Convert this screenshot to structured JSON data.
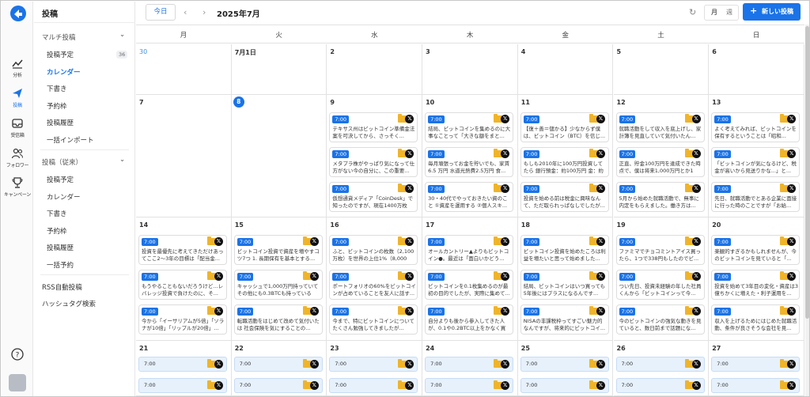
{
  "app": {
    "brand_color": "#1a73e8"
  },
  "rail": [
    {
      "label": "分析",
      "icon": "chart-icon"
    },
    {
      "label": "投稿",
      "icon": "send-icon",
      "active": true
    },
    {
      "label": "受信箱",
      "icon": "inbox-icon"
    },
    {
      "label": "フォロワー",
      "icon": "users-icon"
    },
    {
      "label": "キャンペーン",
      "icon": "trophy-icon"
    }
  ],
  "side": {
    "title": "投稿",
    "group1": {
      "label": "マルチ投稿",
      "items": [
        {
          "label": "投稿予定",
          "badge": "36"
        },
        {
          "label": "カレンダー",
          "active": true
        },
        {
          "label": "下書き"
        },
        {
          "label": "予約枠"
        },
        {
          "label": "投稿履歴"
        },
        {
          "label": "一括インポート"
        }
      ]
    },
    "group2": {
      "label": "投稿（従来）",
      "items": [
        {
          "label": "投稿予定"
        },
        {
          "label": "カレンダー"
        },
        {
          "label": "下書き"
        },
        {
          "label": "予約枠"
        },
        {
          "label": "投稿履歴"
        },
        {
          "label": "一括予約"
        }
      ]
    },
    "extra": [
      {
        "label": "RSS自動投稿"
      },
      {
        "label": "ハッシュタグ検索"
      }
    ]
  },
  "toolbar": {
    "today": "今日",
    "prev": "‹",
    "next": "›",
    "month": "2025年7月",
    "view_month": "月",
    "view_week": "週",
    "new_post": "新しい投稿",
    "new_post_plus": "+"
  },
  "calendar": {
    "weekdays": [
      "月",
      "火",
      "水",
      "木",
      "金",
      "土",
      "日"
    ],
    "weeks": [
      {
        "days": [
          {
            "num": "30",
            "muted": true,
            "posts": []
          },
          {
            "num": "7月1日",
            "posts": []
          },
          {
            "num": "2",
            "posts": []
          },
          {
            "num": "3",
            "posts": []
          },
          {
            "num": "4",
            "posts": []
          },
          {
            "num": "5",
            "posts": []
          },
          {
            "num": "6",
            "posts": []
          }
        ]
      },
      {
        "days": [
          {
            "num": "7",
            "posts": []
          },
          {
            "num": "8",
            "today": true,
            "posts": []
          },
          {
            "num": "9",
            "posts": [
              {
                "time": "7:00",
                "text": "テキサス州はビットコイン準備金法案を可決してから、さっそく..."
              },
              {
                "time": "7:00",
                "text": "メタプラ株がやっぱり気になって仕方がない今の自分に、この重要..."
              },
              {
                "time": "7:00",
                "text": "仮想通貨メディア「CoinDesk」で知ったのですが、現在1400万枚も..."
              }
            ]
          },
          {
            "num": "10",
            "posts": [
              {
                "time": "7:00",
                "text": "結局、ビットコインを集めるのに大事なことって「大きな額をまと..."
              },
              {
                "time": "7:00",
                "text": "毎月頑張ってお金を貯いでも、家賃6.5 万円 水道光熱費2.5万円 食..."
              },
              {
                "time": "7:00",
                "text": "30・40代でやっておきたい資のこと ①資産を運用する ②個人スキ..."
              }
            ]
          },
          {
            "num": "11",
            "posts": [
              {
                "time": "7:00",
                "text": "【復＋善＝儲かる】少なからず僕は、ビットコイン（BTC）を信じ..."
              },
              {
                "time": "7:00",
                "text": "もしも2010年に100万円投資してたら 銀行預金：約100万円 金：約3..."
              },
              {
                "time": "7:00",
                "text": "投資を始める前は税金に興味なんて、ただ取られっぱなしでしたが..."
              }
            ]
          },
          {
            "num": "12",
            "posts": [
              {
                "time": "7:00",
                "text": "就職活動をして収入を底上げし、家計簿を見直していて気付いたん..."
              },
              {
                "time": "7:00",
                "text": "正直、貯金100万円を達成できた時点で、僕は将来1,000万円とか1億..."
              },
              {
                "time": "7:00",
                "text": "5月から始めた就職活動で、無事に内定をもらえました。働き方は..."
              }
            ]
          },
          {
            "num": "13",
            "posts": [
              {
                "time": "7:00",
                "text": "よく考えてみれば、ビットコインを保有するということは「昭和..."
              },
              {
                "time": "7:00",
                "text": "「ビットコインが気になるけど、税金が高いから見送りかな...」と..."
              },
              {
                "time": "7:00",
                "text": "先日、就職活動でとある企業に面接に行った時のことですが「お給..."
              }
            ]
          }
        ]
      },
      {
        "days": [
          {
            "num": "14",
            "posts": [
              {
                "time": "7:00",
                "text": "投資を最優先に考えてきただけあってここ2〜3年の目標は「配当金..."
              },
              {
                "time": "7:00",
                "text": "もうやることもないだろうけど...レバレッジ投資で負けたのに、そ..."
              },
              {
                "time": "7:00",
                "text": "今から「イーサリアムが5倍」「ソラナが10倍」「リップルが20倍」..."
              }
            ]
          },
          {
            "num": "15",
            "posts": [
              {
                "time": "7:00",
                "text": "ビットコイン投資で資産を増やすコツ7つ 1. 長期保有を基本とする..."
              },
              {
                "time": "7:00",
                "text": "キャッシュで1,000万円持っていてその他にも0.3BTCも持っているか..."
              },
              {
                "time": "7:00",
                "text": "転職活動をはじめて改めて気付いたは 社会保険を気にすることの..."
              }
            ]
          },
          {
            "num": "16",
            "posts": [
              {
                "time": "7:00",
                "text": "ふと、ビットコインの枚数（2,100万枚）を世界の上位1%（8,000万..."
              },
              {
                "time": "7:00",
                "text": "ポートフォリオの60%をビットコインが占めていることを友人に話す..."
              },
              {
                "time": "7:00",
                "text": "今まで、特にビットコインについてたくさん勉強してきましたが..."
              }
            ]
          },
          {
            "num": "17",
            "posts": [
              {
                "time": "7:00",
                "text": "オールカントリー▲よりもビットコイン●。最近は「面白いかどう..."
              },
              {
                "time": "7:00",
                "text": "ビットコインを0.1枚集めるのが最初の目的でしたが、実際に集めて..."
              },
              {
                "time": "7:00",
                "text": "自分よりも後から参入してきた人が、0.1や0.2BTC以上をかなく買い..."
              }
            ]
          },
          {
            "num": "18",
            "posts": [
              {
                "time": "7:00",
                "text": "ビットコイン投資を始めたころは利益を増たいと思って始めました..."
              },
              {
                "time": "7:00",
                "text": "結局、ビットコインはいつ買っても5年後にはプラスになるんです..."
              },
              {
                "time": "7:00",
                "text": "NISAの非課税枠ってすごい魅力的なんですが、将来的にビットコイ..."
              }
            ]
          },
          {
            "num": "19",
            "posts": [
              {
                "time": "7:00",
                "text": "ファミマでチョコミントアイス買ったら、1つで338円もしたのでビ..."
              },
              {
                "time": "7:00",
                "text": "つい先日、投資未経験の年した社員くんから「ビットコインって今..."
              },
              {
                "time": "7:00",
                "text": "今のビットコインの強気な動きを見ていると、数日前まで話題にな..."
              }
            ]
          },
          {
            "num": "20",
            "posts": [
              {
                "time": "7:00",
                "text": "楽観的すぎるかもしれませんが、今のビットコインを見ていると「..."
              },
              {
                "time": "7:00",
                "text": "投資を始めて3年目の変化・資産は3億ちかくに増えた・利子運用を..."
              },
              {
                "time": "7:00",
                "text": "収入を上げるためにはじめた就職活動、条件が良さそうな会社を見..."
              }
            ]
          }
        ]
      },
      {
        "days": [
          {
            "num": "21",
            "slots": [
              "7:00",
              "7:00"
            ]
          },
          {
            "num": "22",
            "slots": [
              "7:00",
              "7:00"
            ]
          },
          {
            "num": "23",
            "slots": [
              "7:00",
              "7:00"
            ]
          },
          {
            "num": "24",
            "slots": [
              "7:00",
              "7:00"
            ]
          },
          {
            "num": "25",
            "slots": [
              "7:00",
              "7:00"
            ]
          },
          {
            "num": "26",
            "slots": [
              "7:00",
              "7:00"
            ]
          },
          {
            "num": "27",
            "slots": [
              "7:00",
              "7:00"
            ]
          }
        ]
      }
    ]
  }
}
